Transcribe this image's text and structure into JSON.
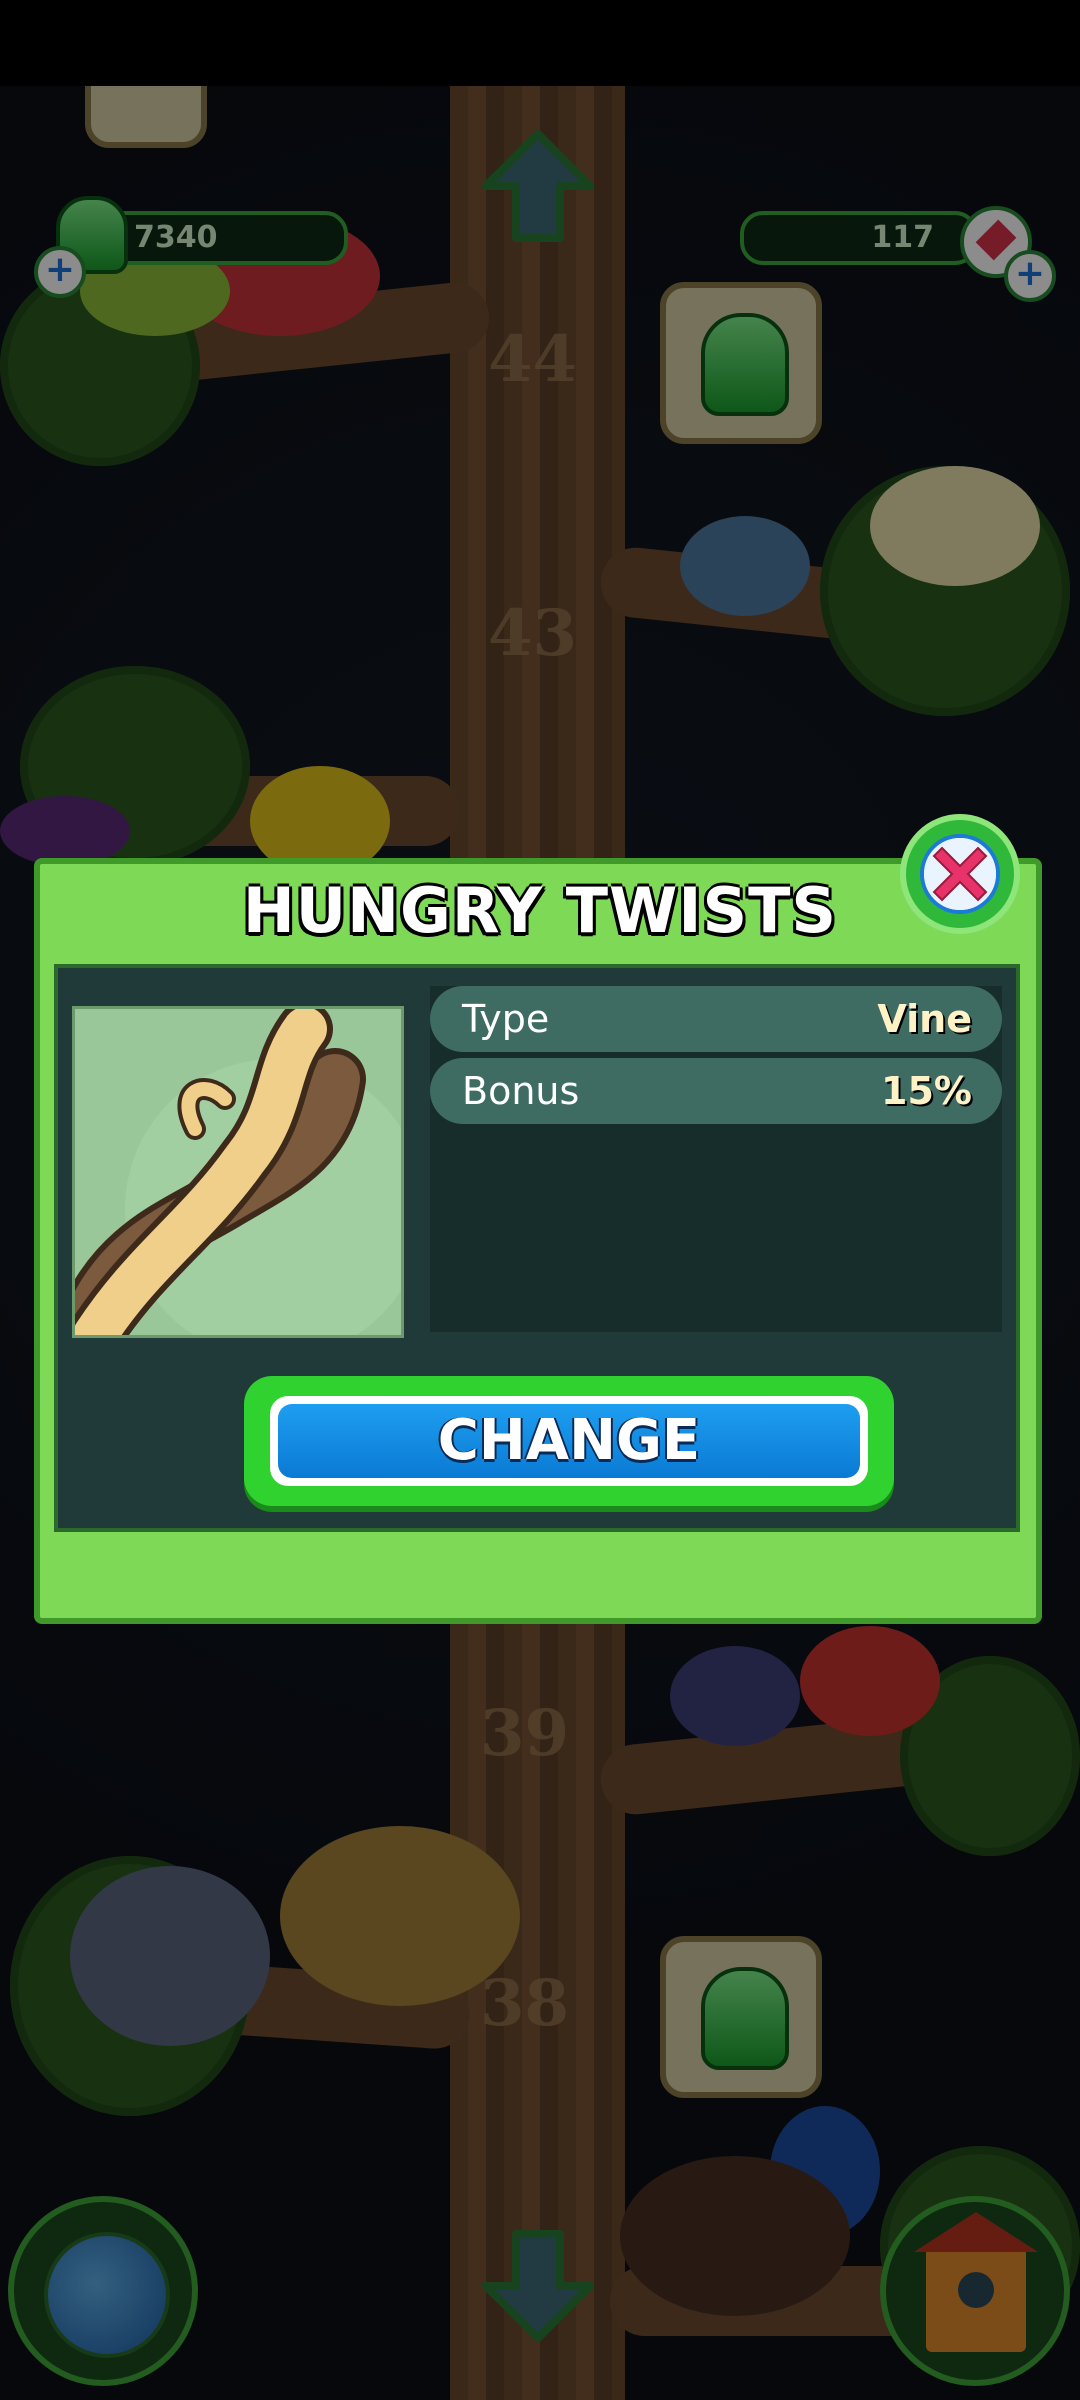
{
  "hud": {
    "gems": "7340",
    "crystals": "117"
  },
  "tree_levels": [
    "44",
    "43",
    "39",
    "38"
  ],
  "dialog": {
    "title": "HUNGRY TWISTS",
    "stats": [
      {
        "label": "Type",
        "value": "Vine"
      },
      {
        "label": "Bonus",
        "value": "15%"
      }
    ],
    "change_label": "CHANGE"
  },
  "icons": {
    "gem_counter": "green-gem-icon",
    "crystal_counter": "red-crystal-icon",
    "close": "close-x-icon",
    "globe": "globe-icon",
    "house": "birdhouse-icon",
    "up": "up-arrow-icon",
    "down": "down-arrow-icon"
  },
  "colors": {
    "dialog_green": "#7ed957",
    "button_blue": "#0a7ad4",
    "close_pink": "#e8326a"
  }
}
